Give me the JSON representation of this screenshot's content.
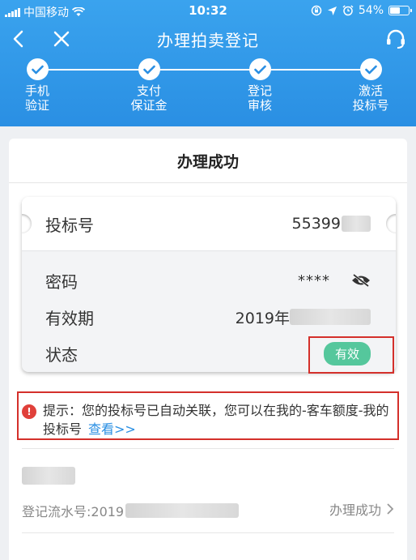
{
  "status_bar": {
    "carrier": "中国移动",
    "time": "10:32",
    "battery": "54%",
    "battery_level": 0.54,
    "icons": [
      "signal-icon",
      "wifi-icon",
      "orientation-lock-icon",
      "location-icon",
      "alarm-icon",
      "battery-icon"
    ]
  },
  "nav": {
    "title": "办理拍卖登记",
    "icons": [
      "back-chevron-icon",
      "close-icon",
      "headset-icon"
    ]
  },
  "steps": [
    {
      "line1": "手机",
      "line2": "验证",
      "done": true
    },
    {
      "line1": "支付",
      "line2": "保证金",
      "done": true
    },
    {
      "line1": "登记",
      "line2": "审核",
      "done": true
    },
    {
      "line1": "激活",
      "line2": "投标号",
      "done": true
    }
  ],
  "result": {
    "title": "办理成功",
    "bid_label": "投标号",
    "bid_value": "55399",
    "password_label": "密码",
    "password_value": "****",
    "validity_label": "有效期",
    "validity_value": "2019年",
    "status_label": "状态",
    "status_value": "有效"
  },
  "tip": {
    "text": "提示：您的投标号已自动关联，您可以在我的-客车额度-我的投标号",
    "link": "查看>>"
  },
  "record": {
    "serial_prefix": "登记流水号:2019",
    "status": "办理成功"
  },
  "colors": {
    "header": "#2a8fe3",
    "badge": "#55c79c",
    "highlight": "#d4302b",
    "link": "#2a8fe3"
  }
}
